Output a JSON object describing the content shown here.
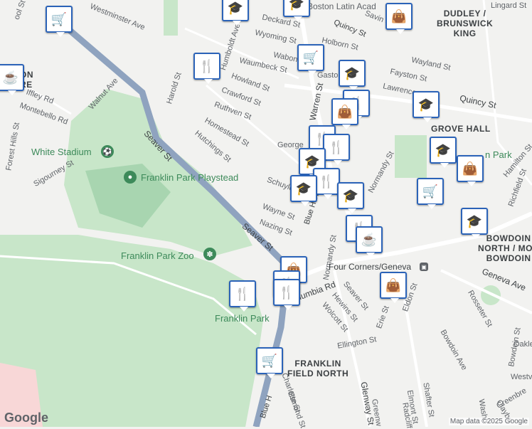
{
  "labels": {
    "westminster_ave": "Westminster Ave",
    "deckard_st": "Deckard St",
    "boston_latin": "Boston Latin Acad",
    "quincy_st_top": "Quincy St",
    "savin_st": "Savin St",
    "lingard_st": "Lingard St",
    "dudley": "DUDLEY /\nBRUNSWICK\nKING",
    "wyoming_st": "Wyoming St",
    "holborn_st": "Holborn St",
    "humboldt_ave": "Humboldt Ave",
    "wabon_st": "Wabon St",
    "waumbeck_st": "Waumbeck St",
    "gaston": "Gaston",
    "wayland_st": "Wayland St",
    "fayston_st": "Fayston St",
    "harold_st": "Harold St",
    "howland_st": "Howland St",
    "crawford_st": "Crawford St",
    "lawrence": "Lawrence",
    "quincy_st_right": "Quincy St",
    "iffley_rd": "Iffley Rd",
    "walnut_ave": "Walnut Ave",
    "ruthven_st": "Ruthven St",
    "warren_st": "Warren St",
    "grove_hall": "GROVE HALL",
    "montebello_rd": "Montebello Rd",
    "homestead_st": "Homestead St",
    "seaver_st_upper": "Seaver St",
    "hutchings_st": "Hutchings St",
    "george": "George",
    "forest_hills_st": "Forest Hills St",
    "white_stadium": "White Stadium",
    "sigourney_st": "Sigourney St",
    "normandy_st_upper": "Normandy St",
    "hamilton_st": "Hamilton St",
    "franklin_park_playstead": "Franklin Park Playstead",
    "schuyler_st": "Schuyler St",
    "richfield_st": "Richfield St",
    "wayne_st": "Wayne St",
    "blue_hill_ave": "Blue Hill Ave",
    "park_partial": "n Park",
    "nazing_st": "Nazing St",
    "seaver_st_lower": "Seaver St",
    "bowdoin_north": "BOWDOIN\nNORTH / MOU\nBOWDOIN",
    "franklin_park_zoo": "Franklin Park Zoo",
    "normandy_st_lower": "Normandy St",
    "four_corners": "Four Corners/Geneva",
    "geneva_ave": "Geneva Ave",
    "columbia_rd": "Columbia Rd",
    "seaver_st_small": "Seaver St",
    "hewins_st": "Hewins St",
    "eldon_st": "Eldon St",
    "rosseter_st": "Rosseter St",
    "erie_st": "Erie St",
    "wolcott_st": "Wolcott St",
    "franklin_park": "Franklin Park",
    "ellington_st": "Ellington St",
    "bowdoin_ave": "Bowdoin Ave",
    "bowdoin_st": "Bowdoin St",
    "oakle": "Oakle",
    "westvi": "Westvi",
    "franklin_field_north": "FRANKLIN\nFIELD NORTH",
    "charlotte_st": "Charlotte St",
    "glenway_st": "Glenway St",
    "esmond_st": "Esmond St",
    "elmont_st": "Elmont St",
    "shafter_st": "Shafter St",
    "greenw": "Greenw",
    "radcliff": "Radcliff",
    "blue_hill_lower": "Blue H",
    "washi": "Washi",
    "greenbre": "Greenbre",
    "claybo": "Claybo",
    "ool_st": "ool St",
    "on_re": "ON\nRE"
  },
  "attribution": "Map data ©2025 Google",
  "logo": "Google",
  "colors": {
    "park": "#c8e6c9",
    "park_dark": "#a8d5b0",
    "road_major": "#8fa3bf",
    "road": "#ffffff",
    "poi": "#2b63b8"
  },
  "pois": [
    {
      "type": "shopping-cart"
    },
    {
      "type": "graduation-cap"
    },
    {
      "type": "graduation-cap"
    },
    {
      "type": "shopping-bag"
    },
    {
      "type": "coffee-cup"
    },
    {
      "type": "restaurant"
    },
    {
      "type": "shopping-cart"
    },
    {
      "type": "graduation-cap"
    },
    {
      "type": "restaurant"
    },
    {
      "type": "shopping-bag"
    },
    {
      "type": "graduation-cap"
    },
    {
      "type": "restaurant"
    },
    {
      "type": "restaurant"
    },
    {
      "type": "graduation-cap"
    },
    {
      "type": "graduation-cap"
    },
    {
      "type": "shopping-bag"
    },
    {
      "type": "shopping-cart"
    },
    {
      "type": "restaurant"
    },
    {
      "type": "graduation-cap"
    },
    {
      "type": "graduation-cap"
    },
    {
      "type": "restaurant"
    },
    {
      "type": "coffee-cup"
    },
    {
      "type": "graduation-cap"
    },
    {
      "type": "shopping-bag"
    },
    {
      "type": "shopping-bag"
    },
    {
      "type": "restaurant"
    },
    {
      "type": "restaurant"
    },
    {
      "type": "restaurant"
    },
    {
      "type": "shopping-cart"
    },
    {
      "type": "shopping-cart"
    }
  ]
}
